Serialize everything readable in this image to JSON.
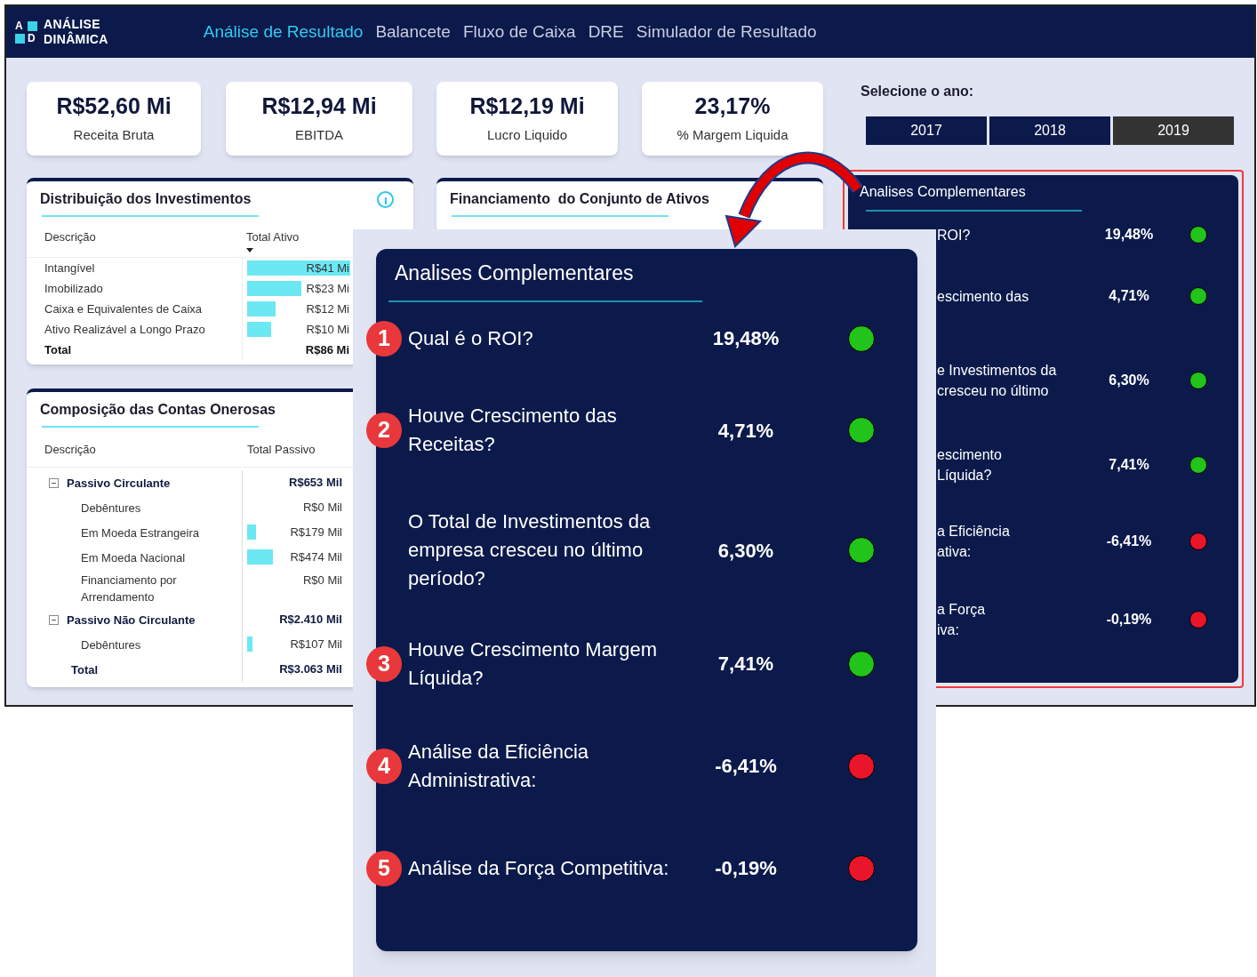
{
  "header": {
    "logo_letters": [
      "A",
      "D"
    ],
    "logo_words": [
      "ANÁLISE",
      "DINÂMICA"
    ],
    "nav": [
      {
        "label": "Análise de Resultado",
        "selected": true
      },
      {
        "label": "Balancete",
        "selected": false
      },
      {
        "label": "Fluxo de Caixa",
        "selected": false
      },
      {
        "label": "DRE",
        "selected": false
      },
      {
        "label": "Simulador de Resultado",
        "selected": false
      }
    ]
  },
  "kpis": [
    {
      "value": "R$52,60 Mi",
      "label": "Receita Bruta"
    },
    {
      "value": "R$12,94 Mi",
      "label": "EBITDA"
    },
    {
      "value": "R$12,19 Mi",
      "label": "Lucro Liquido"
    },
    {
      "value": "23,17%",
      "label": "% Margem Liquida"
    }
  ],
  "investments": {
    "title": "Distribuição dos Investimentos",
    "columns": [
      "Descrição",
      "Total Ativo"
    ],
    "rows": [
      {
        "kind": "item",
        "description": "Intangível",
        "value": "R$41 Mi",
        "level": 1
      },
      {
        "kind": "item",
        "description": "Imobilizado",
        "value": "R$23 Mi",
        "level": 0.53
      },
      {
        "kind": "item",
        "description": "Caixa e Equivalentes de Caixa",
        "value": "R$12 Mi",
        "level": 0.28
      },
      {
        "kind": "item",
        "description": "Ativo Realizável a Longo Prazo",
        "value": "R$10 Mi",
        "level": 0.23
      },
      {
        "kind": "total",
        "description": "Total",
        "value": "R$86 Mi"
      }
    ]
  },
  "financing": {
    "title": "Financiamento  do Conjunto de Ativos"
  },
  "liabilities": {
    "title": "Composição das Contas Onerosas",
    "columns": [
      "Descrição",
      "Total Passivo"
    ],
    "rows": [
      {
        "kind": "group",
        "description": "Passivo Circulante",
        "value": "R$653 Mil",
        "expanded": true,
        "children": [
          {
            "description": "Debêntures",
            "value": "R$0 Mil"
          },
          {
            "description": "Em Moeda Estrangeira",
            "value": "R$179 Mil",
            "level": 0.09
          },
          {
            "description": "Em Moeda Nacional",
            "value": "R$474 Mil",
            "level": 0.27
          },
          {
            "description": "Financiamento por Arrendamento",
            "value": "R$0 Mil"
          }
        ]
      },
      {
        "kind": "group",
        "description": "Passivo Não Circulante",
        "value": "R$2.410 Mil",
        "expanded": true,
        "children": [
          {
            "description": "Debêntures",
            "value": "R$107 Mil",
            "level": 0.06
          }
        ]
      },
      {
        "kind": "total",
        "description": "Total",
        "value": "R$3.063 Mil"
      }
    ]
  },
  "year_selector": {
    "label": "Selecione o ano:",
    "years": [
      {
        "label": "2017",
        "selected": false
      },
      {
        "label": "2018",
        "selected": false
      },
      {
        "label": "2019",
        "selected": true
      }
    ]
  },
  "analysis_panel": {
    "title": "Analises Complementares",
    "rows": [
      {
        "question_lines": [
          "ROI?"
        ],
        "value": "19,48%",
        "color": "#22c31a"
      },
      {
        "question_lines": [
          "escimento das"
        ],
        "value": "4,71%",
        "color": "#22c31a"
      },
      {
        "question_lines": [
          "e Investimentos da",
          "cresceu no último"
        ],
        "value": "6,30%",
        "color": "#22c31a"
      },
      {
        "question_lines": [
          "escimento",
          "Líquida?"
        ],
        "value": "7,41%",
        "color": "#22c31a"
      },
      {
        "question_lines": [
          "a Eficiência",
          "ativa:"
        ],
        "value": "-6,41%",
        "color": "#e8152b"
      },
      {
        "question_lines": [
          "a Força",
          "iva:"
        ],
        "value": "-0,19%",
        "color": "#e8152b"
      }
    ]
  },
  "zoom_panel": {
    "title": "Analises Complementares",
    "rows": [
      {
        "badge": "1",
        "question": "Qual é o ROI?",
        "value": "19,48%",
        "color": "#22c31a"
      },
      {
        "badge": "2",
        "question": "Houve Crescimento das Receitas?",
        "value": "4,71%",
        "color": "#22c31a"
      },
      {
        "question": "O Total de Investimentos da empresa cresceu no último período?",
        "value": "6,30%",
        "color": "#22c31a"
      },
      {
        "badge": "3",
        "question": "Houve Crescimento Margem Líquida?",
        "value": "7,41%",
        "color": "#22c31a"
      },
      {
        "badge": "4",
        "question": "Análise da Eficiência Administrativa:",
        "value": "-6,41%",
        "color": "#e8152b"
      },
      {
        "badge": "5",
        "question": "Análise da Força Competitiva:",
        "value": "-0,19%",
        "color": "#e8152b"
      }
    ]
  }
}
